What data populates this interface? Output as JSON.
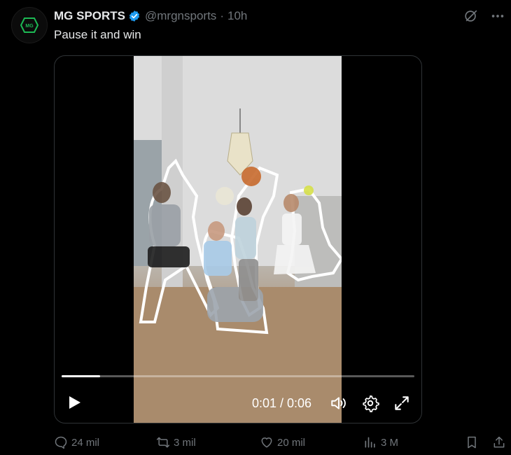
{
  "post": {
    "author_name": "MG SPORTS",
    "handle": "@mrgnsports",
    "separator": "·",
    "time": "10h",
    "text": "Pause it and win"
  },
  "video": {
    "current_time": "0:01 / 0:06",
    "progress": 0.11
  },
  "actions": {
    "replies": "24 mil",
    "reposts": "3 mil",
    "likes": "20 mil",
    "views": "3 M"
  },
  "icons": {
    "verified": "verified-badge-icon",
    "grok": "grok-icon",
    "more": "more-icon",
    "play": "play-icon",
    "volume": "volume-icon",
    "settings": "settings-icon",
    "fullscreen": "fullscreen-icon",
    "reply": "reply-icon",
    "repost": "repost-icon",
    "like": "like-icon",
    "views": "views-icon",
    "bookmark": "bookmark-icon",
    "share": "share-icon"
  },
  "colors": {
    "background": "#000000",
    "text": "#e7e9ea",
    "muted": "#71767b",
    "verified": "#1d9bf0",
    "avatar_logo": "#1db954"
  }
}
